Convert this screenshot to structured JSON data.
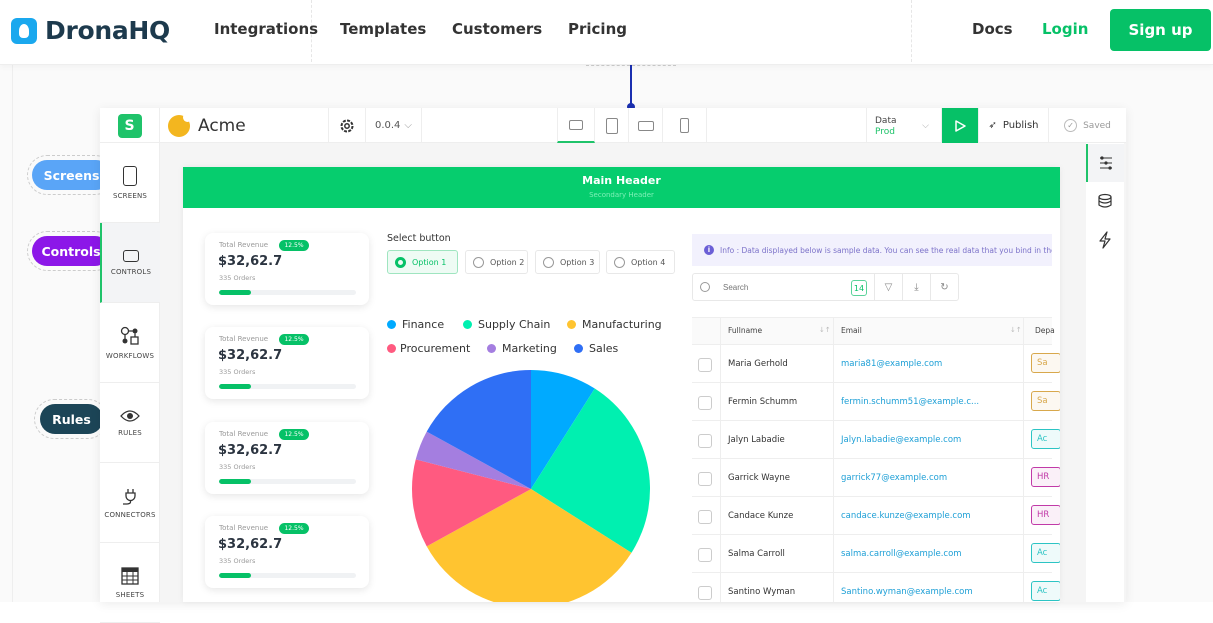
{
  "topnav": {
    "brand": "DronaHQ",
    "links": [
      "Integrations",
      "Templates",
      "Customers",
      "Pricing"
    ],
    "docs": "Docs",
    "login": "Login",
    "signup": "Sign up",
    "accent": "#06c167"
  },
  "callouts": {
    "screens": {
      "label": "Screens",
      "color": "#5aa5f7"
    },
    "controls": {
      "label": "Controls",
      "color": "#8c17e8"
    },
    "rules": {
      "label": "Rules",
      "color": "#1c4557"
    }
  },
  "builder": {
    "app_name": "Acme",
    "version": "0.0.4",
    "data_label": "Data",
    "data_env": "Prod",
    "publish": "Publish",
    "saved": "Saved",
    "devices": [
      "laptop-icon",
      "tablet-icon",
      "tablet-landscape-icon",
      "phone-icon"
    ],
    "left_sidebar": [
      "SCREENS",
      "CONTROLS",
      "WORKFLOWS",
      "RULES",
      "CONNECTORS",
      "SHEETS"
    ],
    "right_sidebar": [
      "sliders-icon",
      "database-icon",
      "bolt-icon"
    ]
  },
  "canvas": {
    "main_header": "Main Header",
    "secondary_header": "Secondary Header",
    "cards": [
      {
        "title": "Total Revenue",
        "badge": "12.5%",
        "value": "$32,62.7",
        "orders": "335 Orders",
        "progress": 0.23
      },
      {
        "title": "Total Revenue",
        "badge": "12.5%",
        "value": "$32,62.7",
        "orders": "335 Orders",
        "progress": 0.23
      },
      {
        "title": "Total Revenue",
        "badge": "12.5%",
        "value": "$32,62.7",
        "orders": "335 Orders",
        "progress": 0.23
      },
      {
        "title": "Total Revenue",
        "badge": "12.5%",
        "value": "$32,62.7",
        "orders": "335 Orders",
        "progress": 0.23
      }
    ],
    "select_label": "Select button",
    "options": [
      "Option 1",
      "Option 2",
      "Option 3",
      "Option 4"
    ],
    "selected_option": "Option 1",
    "info": "Info : Data displayed below is sample data. You can see the real data that you bind in the",
    "search_placeholder": "Search",
    "row_count": "14",
    "columns": [
      "Fullname",
      "Email",
      "Depa"
    ],
    "rows": [
      {
        "name": "Maria Gerhold",
        "email": "maria81@example.com",
        "dept": "Sa",
        "dept_color": "#d8a84c"
      },
      {
        "name": "Fermin Schumm",
        "email": "fermin.schumm51@example.c...",
        "dept": "Sa",
        "dept_color": "#d8a84c"
      },
      {
        "name": "Jalyn Labadie",
        "email": "Jalyn.labadie@example.com",
        "dept": "Ac",
        "dept_color": "#2cc4c4"
      },
      {
        "name": "Garrick Wayne",
        "email": "garrick77@example.com",
        "dept": "HR",
        "dept_color": "#c13aa8"
      },
      {
        "name": "Candace Kunze",
        "email": "candace.kunze@example.com",
        "dept": "HR",
        "dept_color": "#c13aa8"
      },
      {
        "name": "Salma Carroll",
        "email": "salma.carroll@example.com",
        "dept": "Ac",
        "dept_color": "#2cc4c4"
      },
      {
        "name": "Santino Wyman",
        "email": "Santino.wyman@example.com",
        "dept": "Ac",
        "dept_color": "#2cc4c4"
      }
    ]
  },
  "chart_data": {
    "type": "pie",
    "title": "",
    "legend": "top",
    "categories": [
      "Finance",
      "Supply Chain",
      "Manufacturing",
      "Procurement",
      "Marketing",
      "Sales"
    ],
    "values": [
      9,
      25,
      33,
      12,
      4,
      17
    ],
    "colors": [
      "#00aaff",
      "#00f0b0",
      "#ffc430",
      "#ff5a80",
      "#a47ee0",
      "#2f6ff5"
    ]
  }
}
